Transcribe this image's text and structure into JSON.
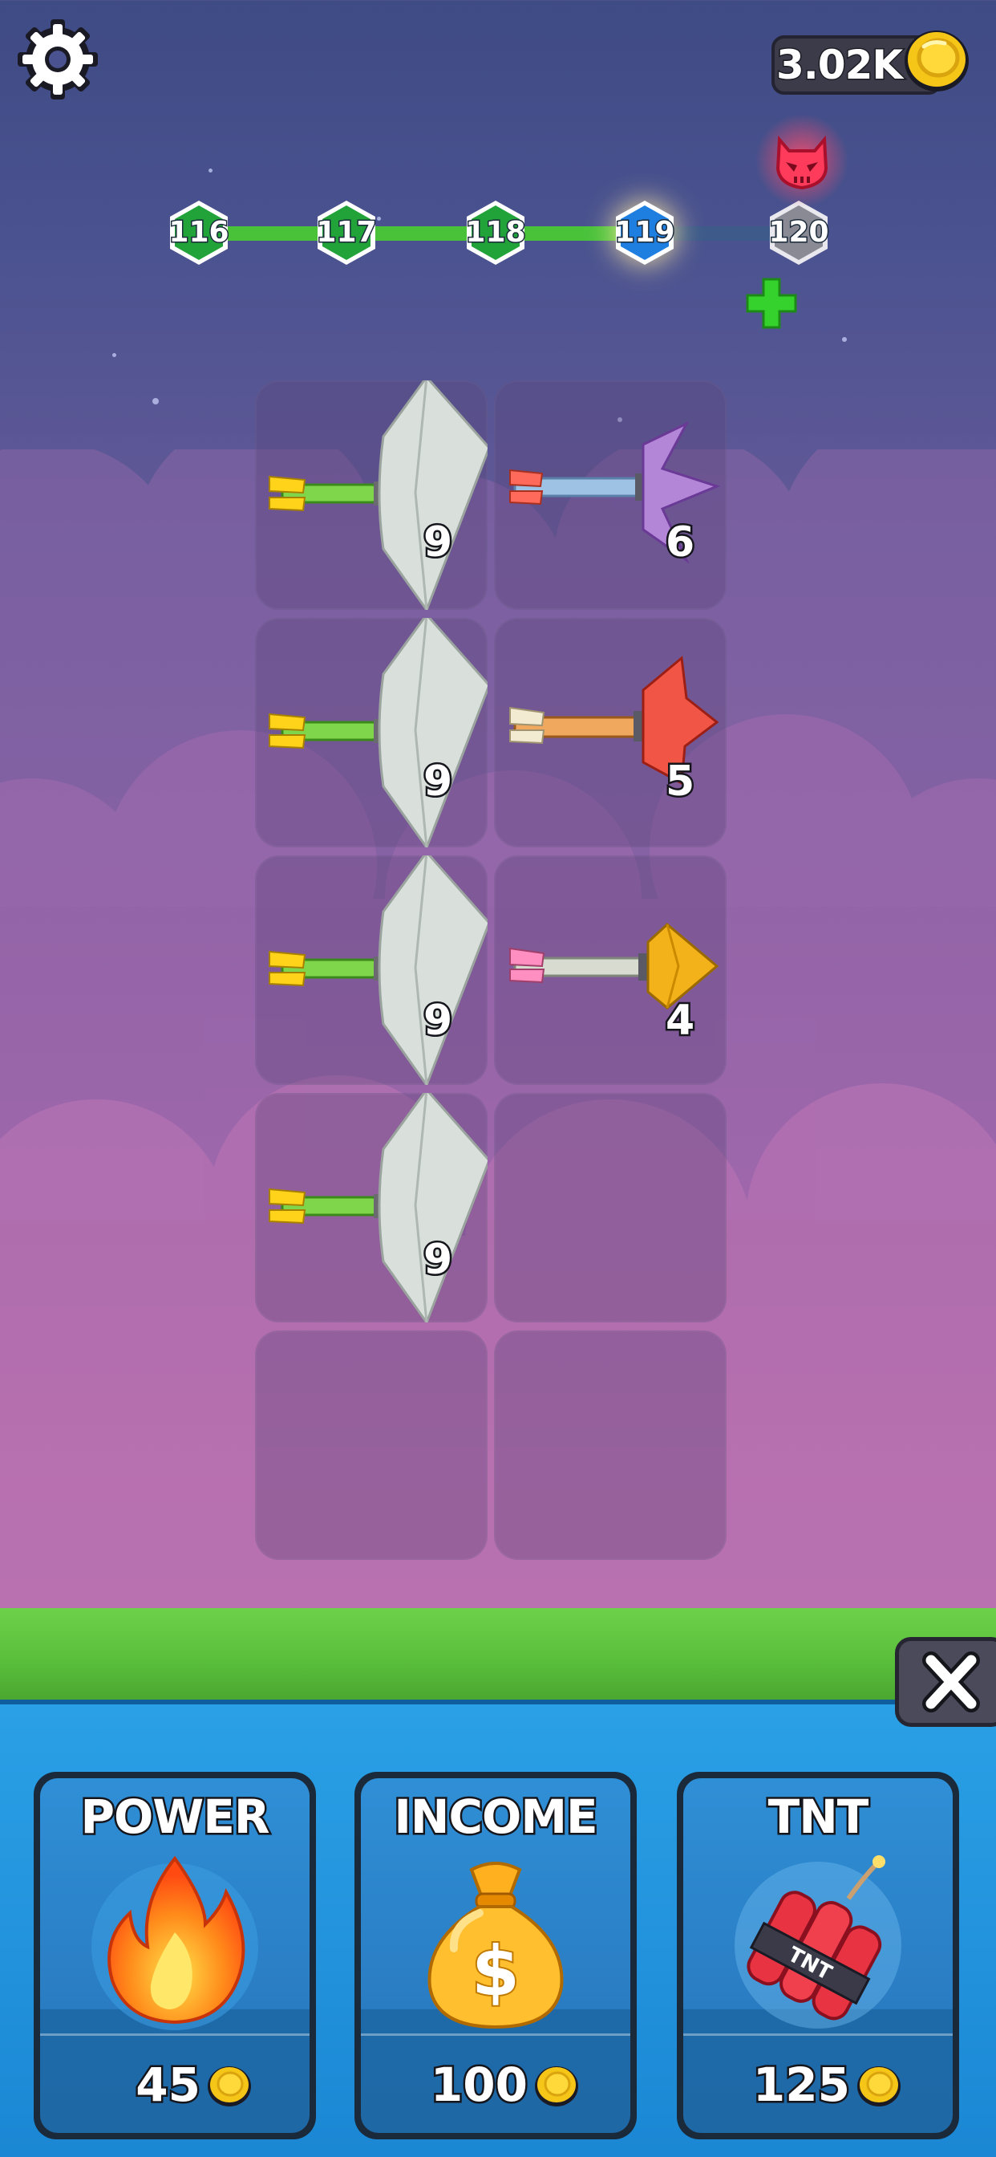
{
  "hud": {
    "coins": "3.02K"
  },
  "levels": [
    "116",
    "117",
    "118",
    "119",
    "120"
  ],
  "grid": {
    "cells": [
      {
        "level": "9"
      },
      {
        "level": "6"
      },
      {
        "level": "9"
      },
      {
        "level": "5"
      },
      {
        "level": "9"
      },
      {
        "level": "4"
      },
      {
        "level": "9"
      },
      {
        "level": ""
      },
      {
        "level": ""
      },
      {
        "level": ""
      }
    ]
  },
  "shop": {
    "cards": [
      {
        "title": "POWER",
        "price": "45"
      },
      {
        "title": "INCOME",
        "price": "100"
      },
      {
        "title": "TNT",
        "price": "125"
      }
    ]
  },
  "colors": {
    "track_done": "#49c23a",
    "hex_done": "#22a33a",
    "hex_current": "#1f7fe0",
    "hex_locked": "#8a8a95",
    "boss": "#ff3b5c",
    "grass": "#5fc43e",
    "shop_bg": "#1e8fdb"
  }
}
